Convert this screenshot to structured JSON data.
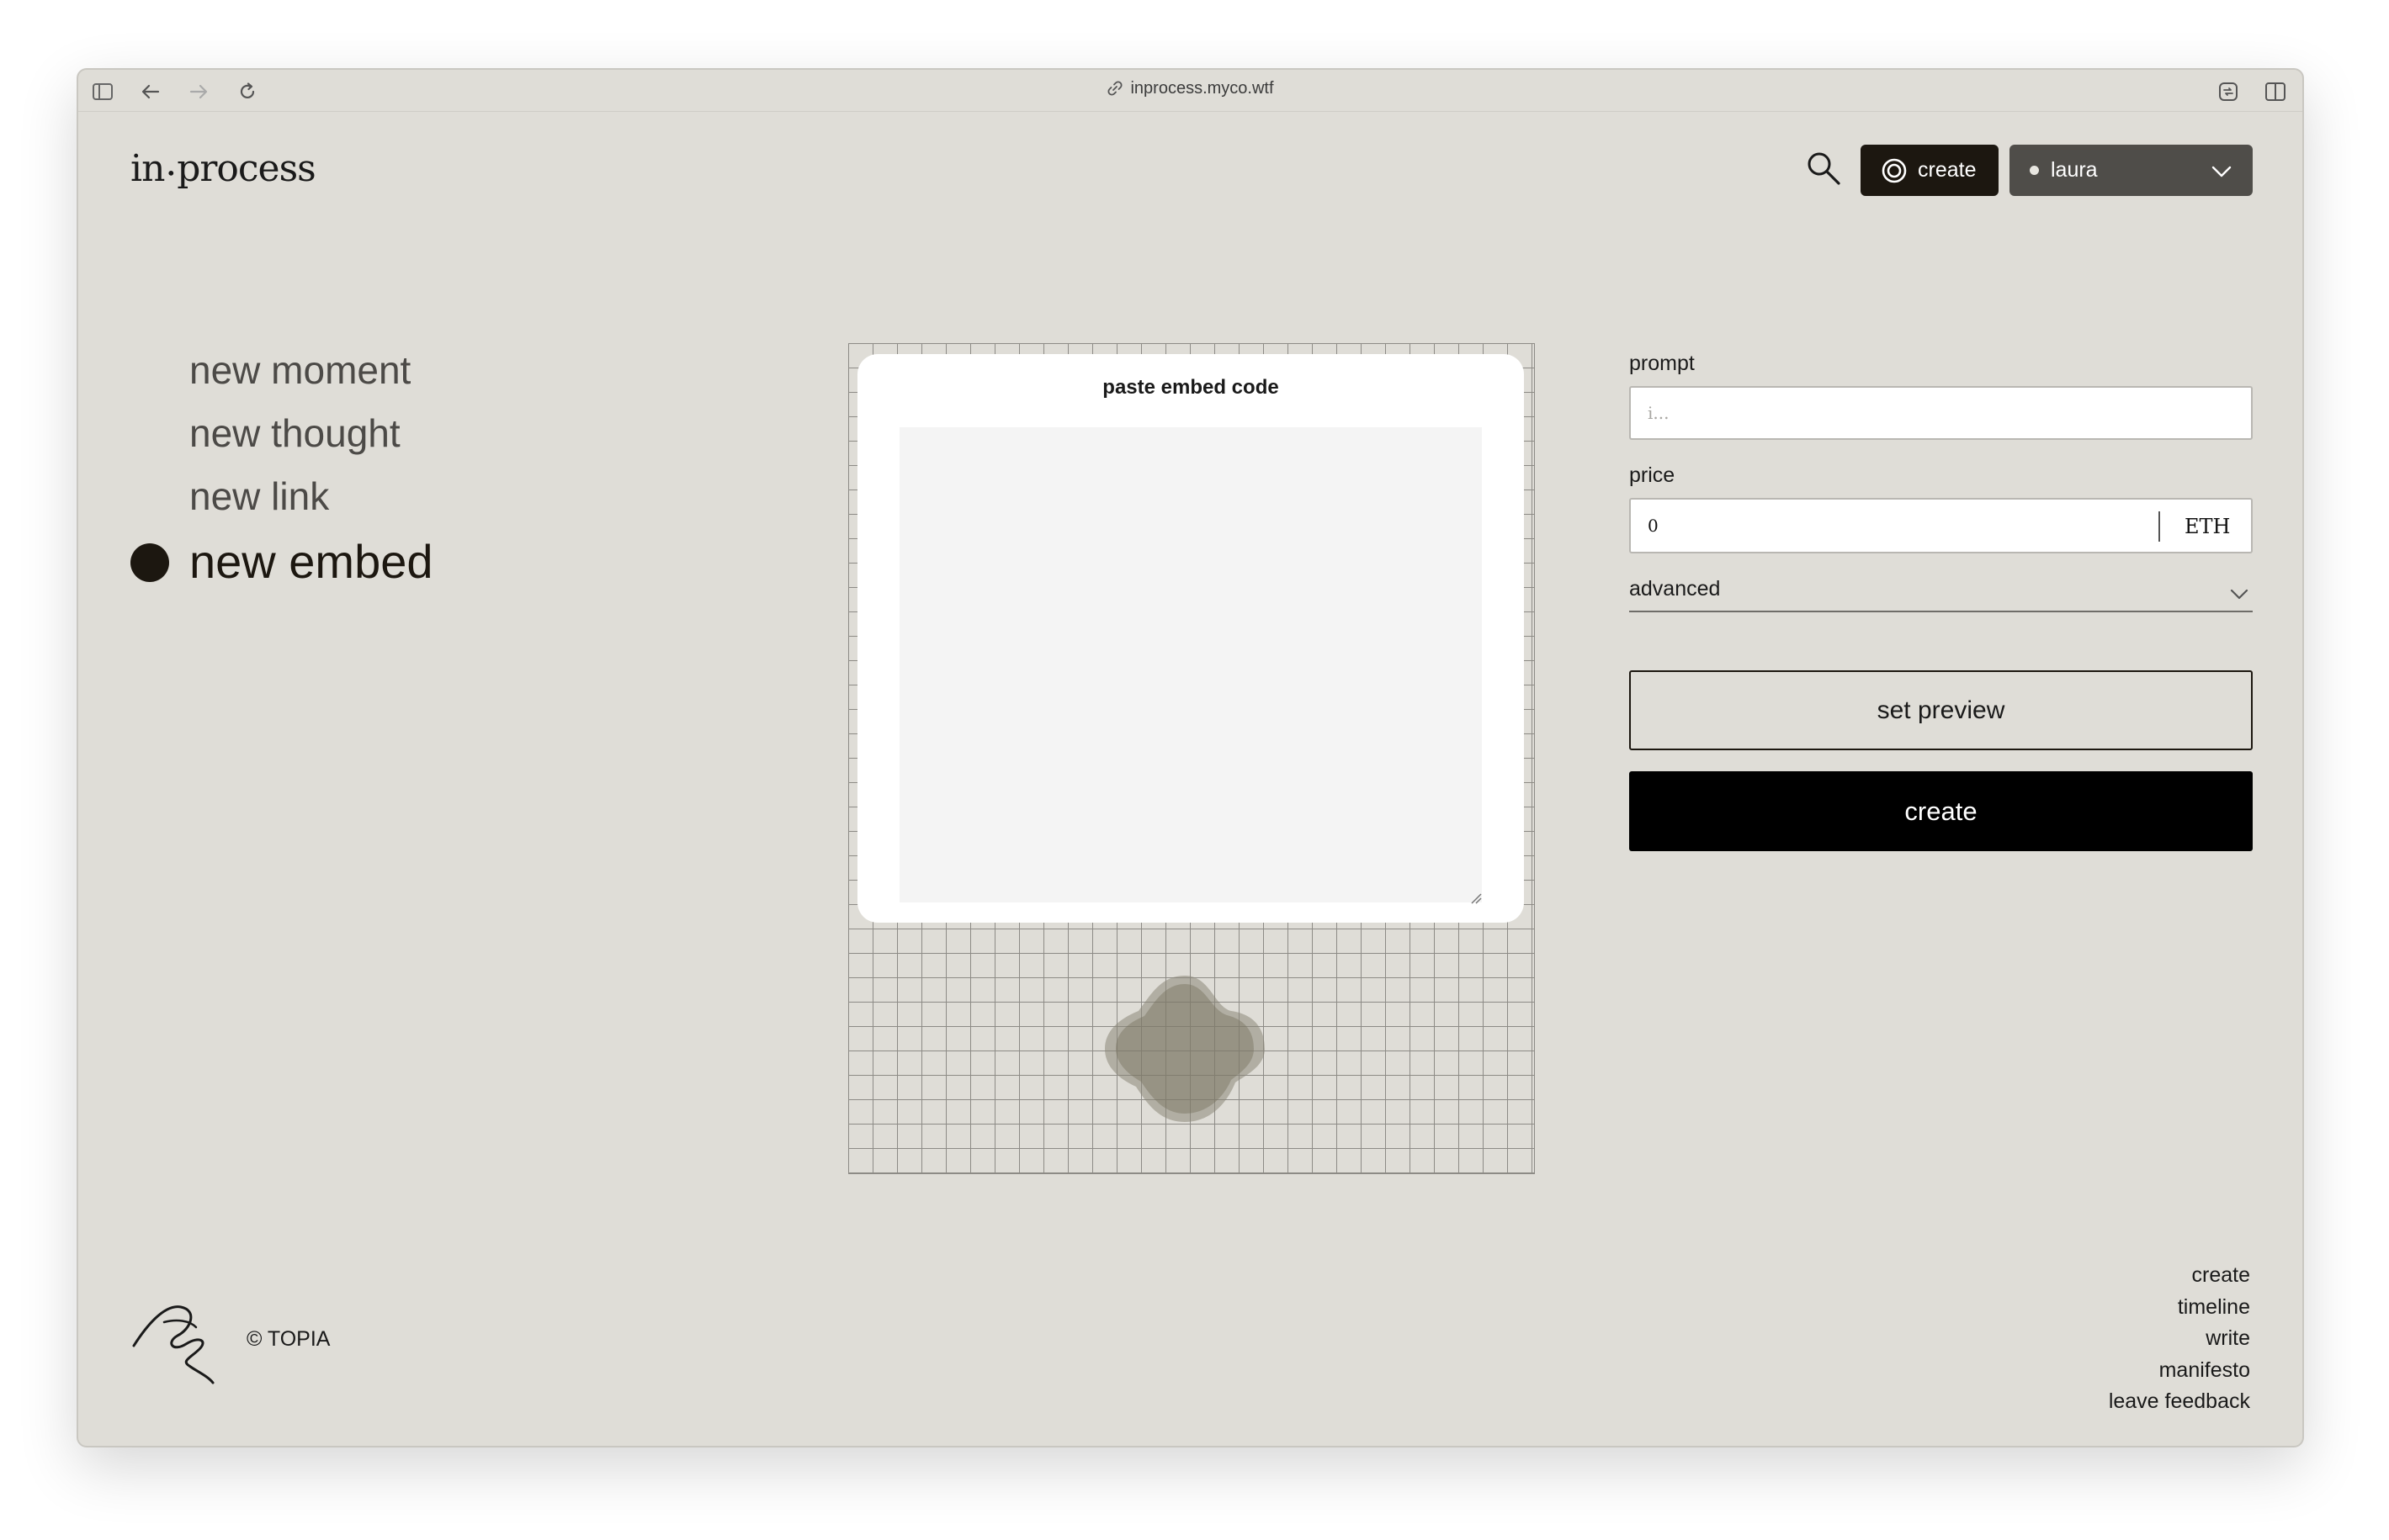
{
  "browser": {
    "url": "inprocess.myco.wtf"
  },
  "header": {
    "logo_left": "in",
    "logo_dot": "•",
    "logo_right": "process",
    "create_label": "create",
    "user_name": "laura"
  },
  "menu": {
    "items": [
      {
        "label": "new moment",
        "active": false
      },
      {
        "label": "new thought",
        "active": false
      },
      {
        "label": "new link",
        "active": false
      },
      {
        "label": "new embed",
        "active": true
      }
    ]
  },
  "embed": {
    "title": "paste embed code",
    "value": ""
  },
  "form": {
    "prompt_label": "prompt",
    "prompt_placeholder": "i...",
    "price_label": "price",
    "price_value": "0",
    "price_unit": "ETH",
    "advanced_label": "advanced",
    "set_preview_label": "set preview",
    "create_label": "create"
  },
  "footer": {
    "copyright": "© TOPIA",
    "links": [
      "create",
      "timeline",
      "write",
      "manifesto",
      "leave feedback"
    ]
  },
  "colors": {
    "background": "#dfddd7",
    "dark": "#1c1710",
    "user_button": "#4f4d49"
  }
}
